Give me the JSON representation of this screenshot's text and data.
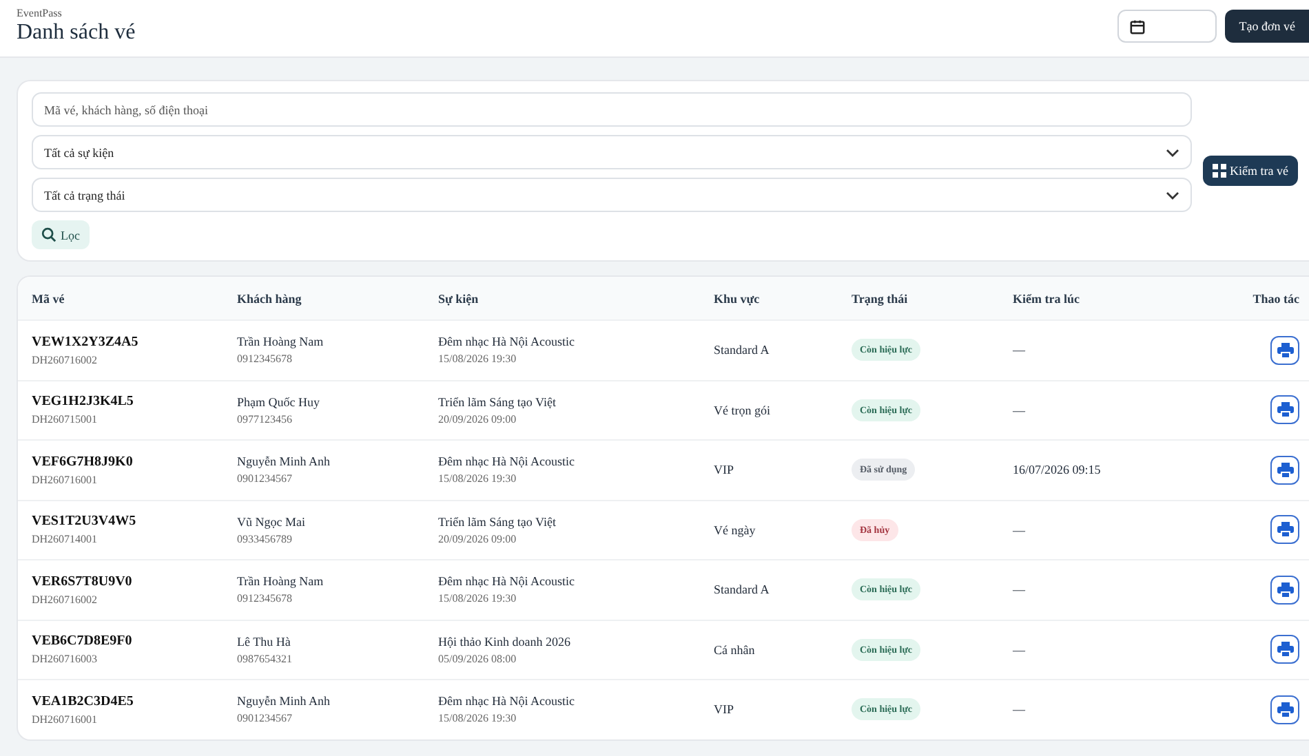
{
  "header": {
    "brand": "EventPass",
    "title": "Danh sách vé",
    "create_button": "Tạo đơn vé"
  },
  "filters": {
    "search": {
      "placeholder": "Mã vé, khách hàng, số điện thoại"
    },
    "event_select": "Tất cả sự kiện",
    "status_select": "Tất cả trạng thái",
    "filter_button": "Lọc",
    "check_button": "Kiểm tra vé"
  },
  "table": {
    "columns": [
      "Mã vé",
      "Khách hàng",
      "Sự kiện",
      "Khu vực",
      "Trạng thái",
      "Kiểm tra lúc",
      "Thao tác"
    ],
    "rows": [
      {
        "ticket": "VEW1X2Y3Z4A5",
        "order": "DH260716002",
        "customer": "Trần Hoàng Nam",
        "phone": "0912345678",
        "event": "Đêm nhạc Hà Nội Acoustic",
        "event_time": "15/08/2026 19:30",
        "zone": "Standard A",
        "status": {
          "kind": "valid",
          "label": "Còn hiệu lực"
        },
        "checked_at": "—"
      },
      {
        "ticket": "VEG1H2J3K4L5",
        "order": "DH260715001",
        "customer": "Phạm Quốc Huy",
        "phone": "0977123456",
        "event": "Triển lãm Sáng tạo Việt",
        "event_time": "20/09/2026 09:00",
        "zone": "Vé trọn gói",
        "status": {
          "kind": "valid",
          "label": "Còn hiệu lực"
        },
        "checked_at": "—"
      },
      {
        "ticket": "VEF6G7H8J9K0",
        "order": "DH260716001",
        "customer": "Nguyễn Minh Anh",
        "phone": "0901234567",
        "event": "Đêm nhạc Hà Nội Acoustic",
        "event_time": "15/08/2026 19:30",
        "zone": "VIP",
        "status": {
          "kind": "used",
          "label": "Đã sử dụng"
        },
        "checked_at": "16/07/2026 09:15"
      },
      {
        "ticket": "VES1T2U3V4W5",
        "order": "DH260714001",
        "customer": "Vũ Ngọc Mai",
        "phone": "0933456789",
        "event": "Triển lãm Sáng tạo Việt",
        "event_time": "20/09/2026 09:00",
        "zone": "Vé ngày",
        "status": {
          "kind": "cancelled",
          "label": "Đã hủy"
        },
        "checked_at": "—"
      },
      {
        "ticket": "VER6S7T8U9V0",
        "order": "DH260716002",
        "customer": "Trần Hoàng Nam",
        "phone": "0912345678",
        "event": "Đêm nhạc Hà Nội Acoustic",
        "event_time": "15/08/2026 19:30",
        "zone": "Standard A",
        "status": {
          "kind": "valid",
          "label": "Còn hiệu lực"
        },
        "checked_at": "—"
      },
      {
        "ticket": "VEB6C7D8E9F0",
        "order": "DH260716003",
        "customer": "Lê Thu Hà",
        "phone": "0987654321",
        "event": "Hội thảo Kinh doanh 2026",
        "event_time": "05/09/2026 08:00",
        "zone": "Cá nhân",
        "status": {
          "kind": "valid",
          "label": "Còn hiệu lực"
        },
        "checked_at": "—"
      },
      {
        "ticket": "VEA1B2C3D4E5",
        "order": "DH260716001",
        "customer": "Nguyễn Minh Anh",
        "phone": "0901234567",
        "event": "Đêm nhạc Hà Nội Acoustic",
        "event_time": "15/08/2026 19:30",
        "zone": "VIP",
        "status": {
          "kind": "valid",
          "label": "Còn hiệu lực"
        },
        "checked_at": "—"
      }
    ]
  }
}
